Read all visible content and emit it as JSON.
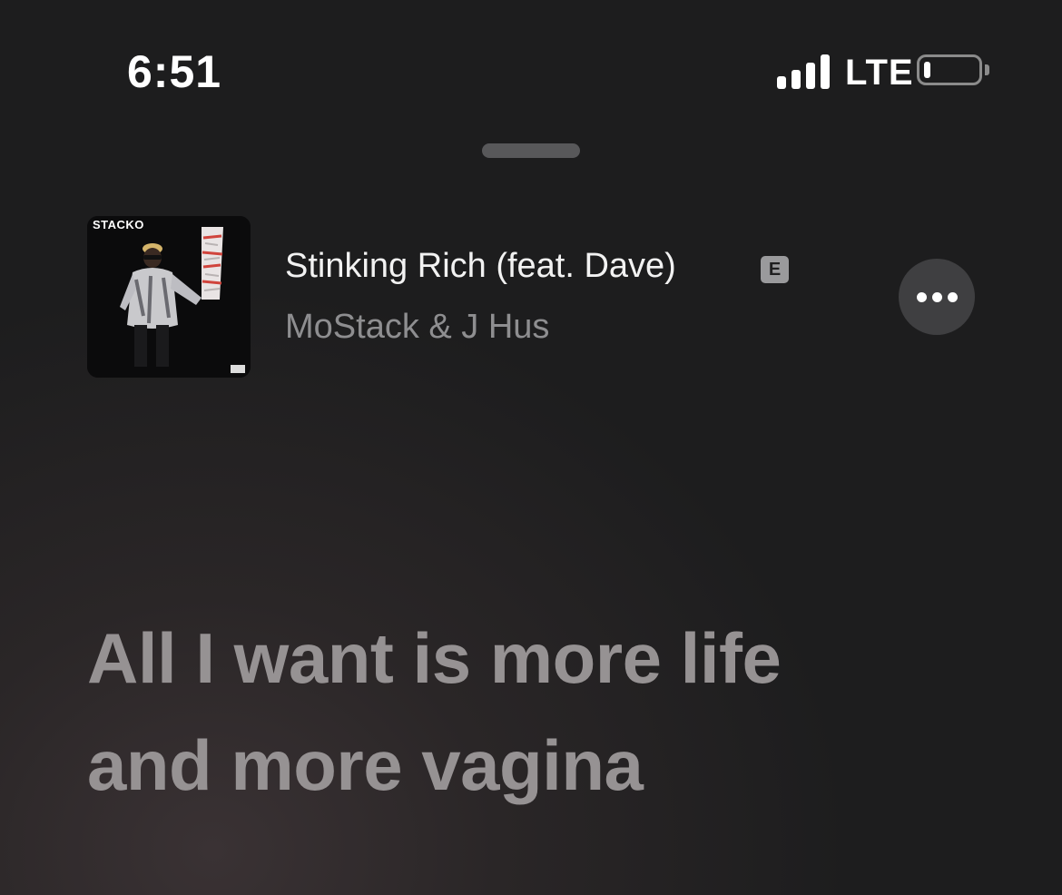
{
  "status_bar": {
    "time": "6:51",
    "network": "LTE",
    "signal_bars": 4,
    "battery_level": 0.12
  },
  "now_playing": {
    "artwork_label": "STACKO",
    "title": "Stinking Rich (feat. Dave)",
    "explicit_badge": "E",
    "artist": "MoStack & J Hus",
    "more_icon": "ellipsis-icon"
  },
  "lyrics": {
    "lines": [
      "All I want is more life",
      "and more vagina"
    ]
  },
  "colors": {
    "background": "#1d1d1e",
    "lyric_text": "#969293",
    "secondary_text": "#8e8e90"
  }
}
